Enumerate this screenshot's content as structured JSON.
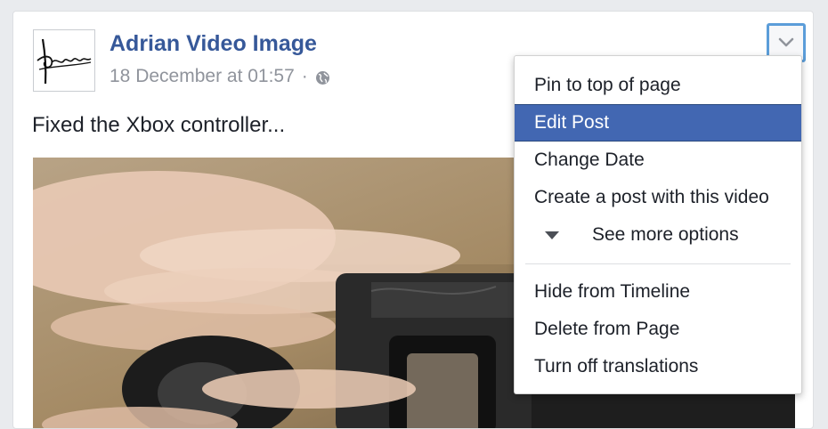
{
  "post": {
    "page_name": "Adrian Video Image",
    "timestamp": "18 December at 01:57",
    "separator": "·",
    "privacy_icon": "globe-icon",
    "text": "Fixed the Xbox controller...",
    "avatar_signature": "Adrian"
  },
  "menu_button": {
    "icon": "chevron-down-icon",
    "accent_color": "#5b9dd9"
  },
  "dropdown": {
    "items_top": [
      {
        "label": "Pin to top of page"
      },
      {
        "label": "Edit Post",
        "active": true
      },
      {
        "label": "Change Date"
      },
      {
        "label": "Create a post with this video"
      }
    ],
    "see_more": {
      "label": "See more options",
      "icon": "triangle-down-icon"
    },
    "items_bottom": [
      {
        "label": "Hide from Timeline"
      },
      {
        "label": "Delete from Page"
      },
      {
        "label": "Turn off translations"
      }
    ],
    "highlight_color": "#4267b2"
  },
  "colors": {
    "link": "#365899",
    "meta": "#90949c",
    "text": "#1d2129",
    "background": "#e9ebee"
  }
}
